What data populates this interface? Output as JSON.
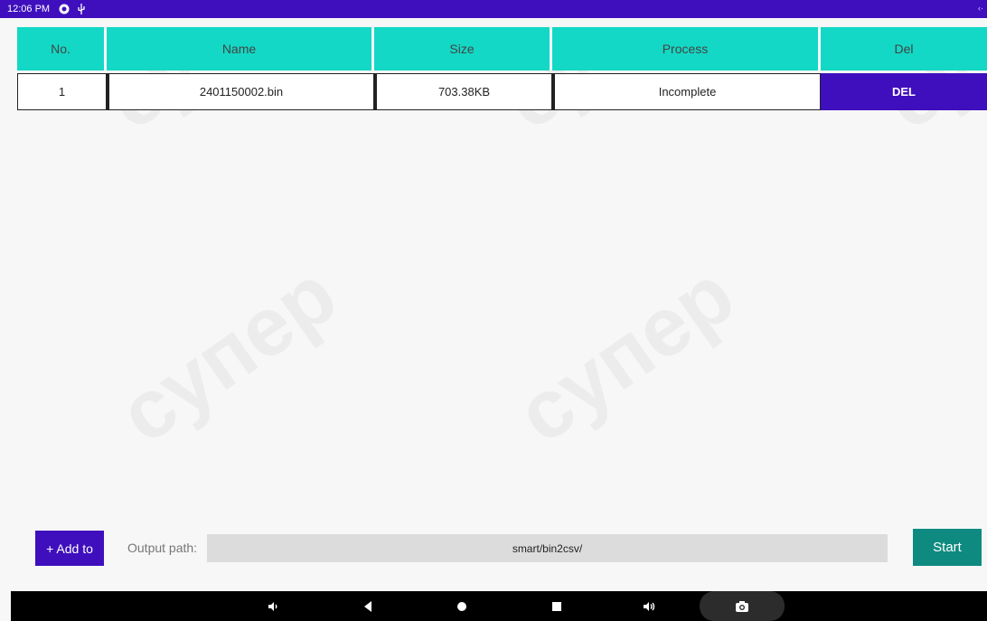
{
  "status_bar": {
    "time": "12:06 PM",
    "icons": [
      "settings-circle-icon",
      "usb-icon"
    ],
    "right_indicator": "‹·"
  },
  "table": {
    "headers": [
      "No.",
      "Name",
      "Size",
      "Process",
      "Del"
    ],
    "rows": [
      {
        "no": "1",
        "name": "2401150002.bin",
        "size": "703.38KB",
        "process": "Incomplete",
        "del_label": "DEL"
      }
    ]
  },
  "bottom": {
    "add_label": "+ Add to",
    "output_label": "Output path:",
    "output_value": "smart/bin2csv/",
    "start_label": "Start"
  },
  "nav": {
    "icons": [
      "volume-down-icon",
      "back-icon",
      "home-icon",
      "recents-icon",
      "volume-up-icon",
      "screenshot-icon"
    ]
  },
  "colors": {
    "accent": "#3f0fbd",
    "header_teal": "#13d8c5",
    "start_teal": "#0e8a80"
  }
}
